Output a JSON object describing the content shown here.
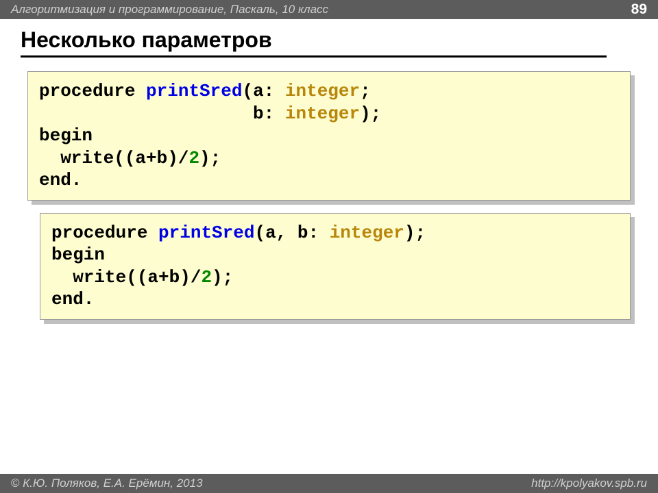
{
  "header": {
    "course": "Алгоритмизация и программирование, Паскаль, 10 класс",
    "page": "89"
  },
  "title": "Несколько параметров",
  "code1": {
    "l1a": "procedure ",
    "l1b": "printSred",
    "l1c": "(a: ",
    "l1d": "integer",
    "l1e": ";",
    "l2a": "                    b: ",
    "l2b": "integer",
    "l2c": ");",
    "l3": "begin",
    "l4a": "  write((a+b)/",
    "l4b": "2",
    "l4c": ");",
    "l5": "end."
  },
  "code2": {
    "l1a": "procedure ",
    "l1b": "printSred",
    "l1c": "(a, b: ",
    "l1d": "integer",
    "l1e": ");",
    "l2": "begin",
    "l3a": "  write((a+b)/",
    "l3b": "2",
    "l3c": ");",
    "l4": "end."
  },
  "footer": {
    "authors": " К.Ю. Поляков, Е.А. Ерёмин, 2013",
    "url": "http://kpolyakov.spb.ru"
  }
}
